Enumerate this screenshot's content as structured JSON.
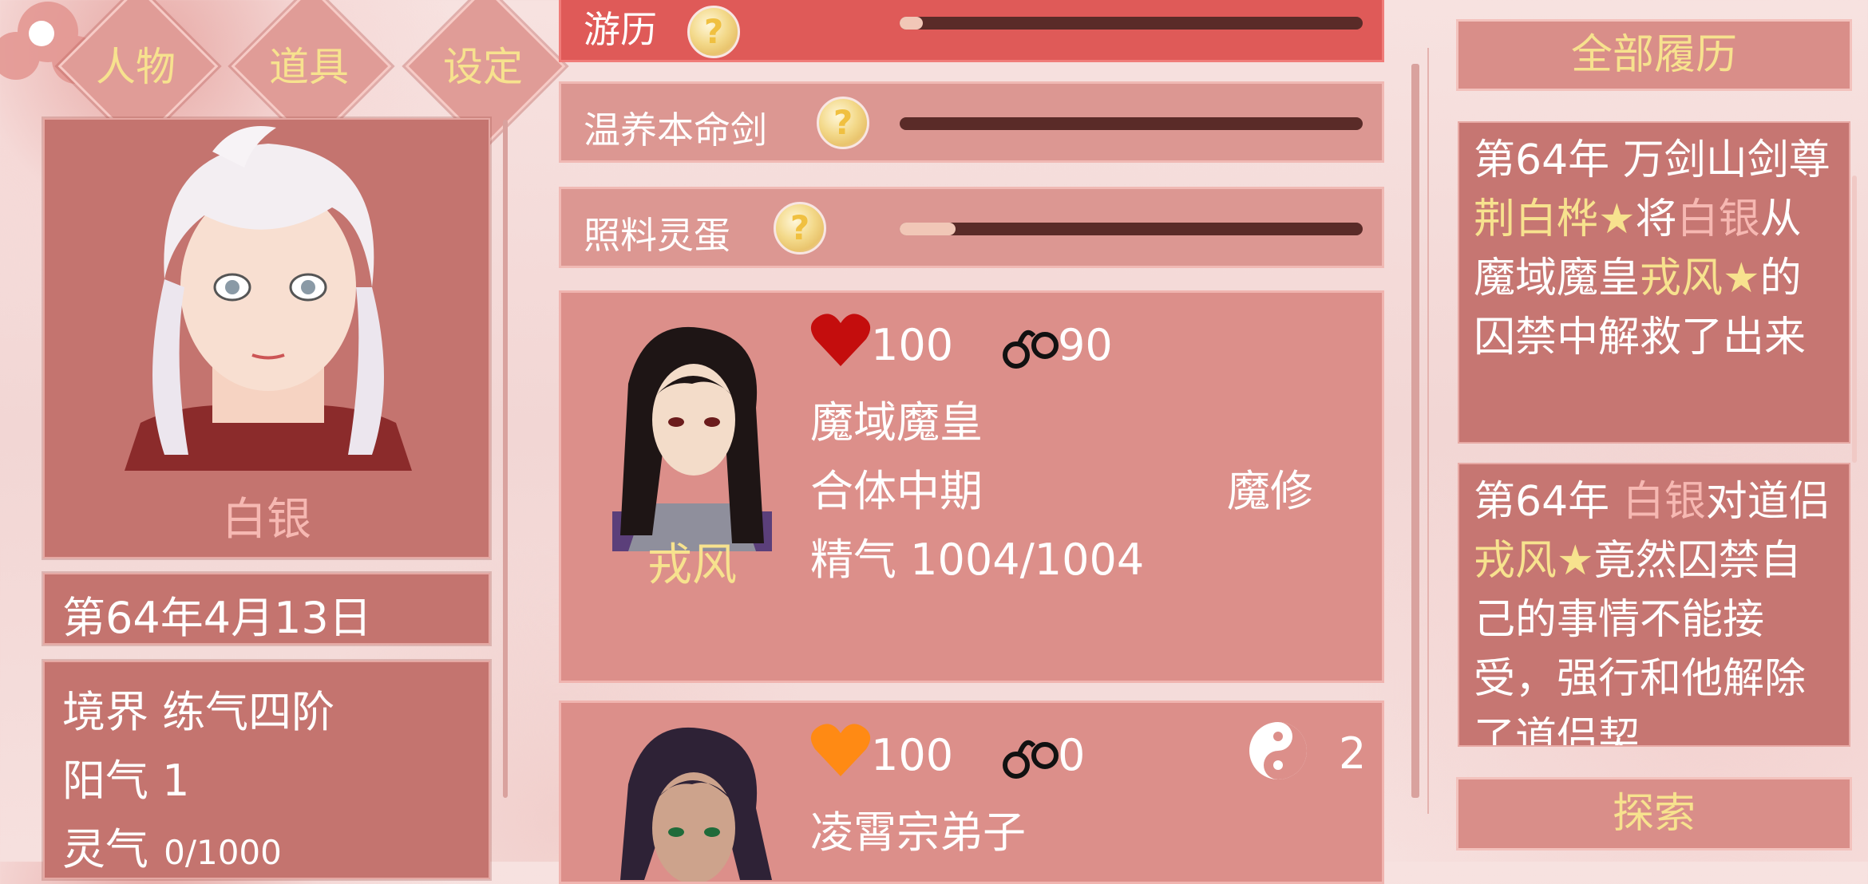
{
  "nav": {
    "characters": "人物",
    "items": "道具",
    "settings": "设定"
  },
  "player": {
    "name": "白银",
    "date": "第64年4月13日",
    "realm": "境界 练气四阶",
    "yang_qi": "阳气 1",
    "ling_qi_label": "灵气",
    "ling_qi_value": "0/1000"
  },
  "tasks": [
    {
      "label": "游历",
      "progress": 0.05
    },
    {
      "label": "温养本命剑",
      "progress": 0.0
    },
    {
      "label": "照料灵蛋",
      "progress": 0.12
    }
  ],
  "characters": [
    {
      "name": "戎风",
      "affection": "100",
      "restraint": "90",
      "title": "魔域魔皇",
      "stage": "合体中期",
      "faction": "魔修",
      "essence": "精气 1004/1004"
    },
    {
      "affection": "100",
      "restraint": "0",
      "dao_count": "2",
      "title": "凌霄宗弟子"
    }
  ],
  "log": {
    "header": "全部履历",
    "entry1": {
      "p1": "第64年 万剑山剑尊",
      "n1": "荆白桦★",
      "p2": "将",
      "n2": "白银",
      "p3": "从魔域魔皇",
      "n3": "戎风★",
      "p4": "的囚禁中解救了出来"
    },
    "entry2": {
      "p1": "第64年 ",
      "n1": "白银",
      "p2": "对道侣",
      "n2": "戎风★",
      "p3": "竟然囚禁自己的事情不能接受，强行和他解除了道侣契"
    }
  },
  "explore_button": "探索",
  "colors": {
    "panel": "#c4746f",
    "highlight_yellow": "#f7e28e",
    "highlight_pink": "#f6b8b2",
    "heart_red": "#c40d0d",
    "heart_orange": "#ff8a14"
  }
}
